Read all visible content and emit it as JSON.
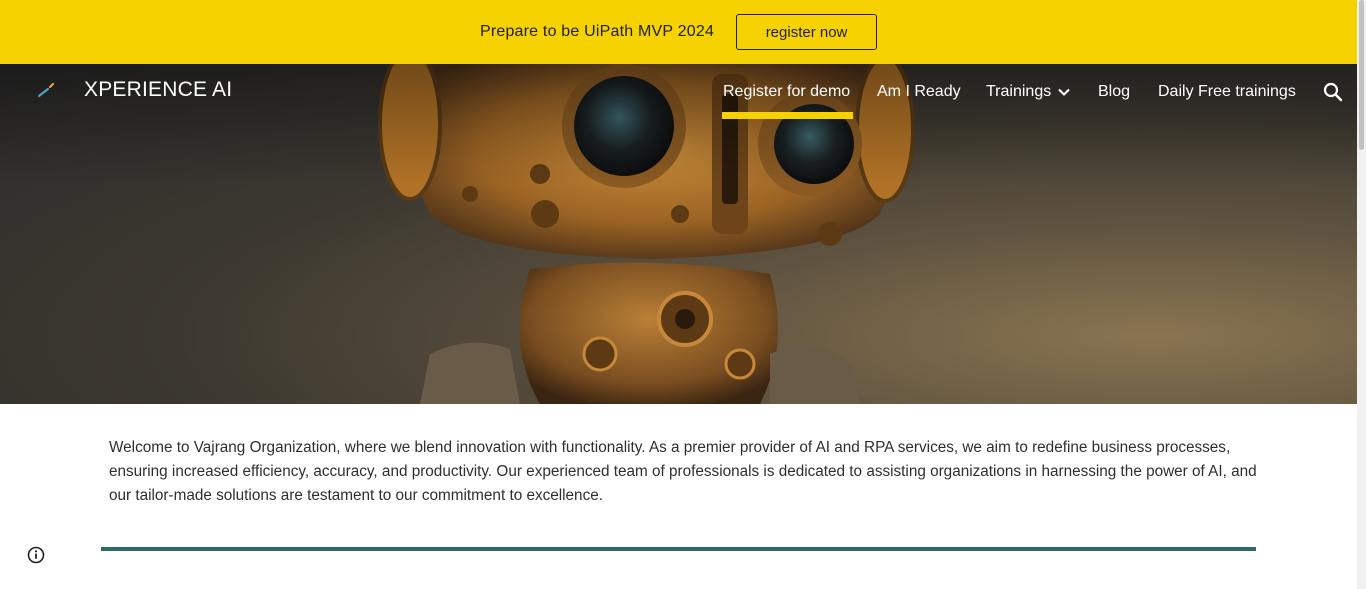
{
  "banner": {
    "text": "Prepare to be UiPath MVP 2024",
    "button_label": "register now",
    "background": "#f5d200"
  },
  "header": {
    "site_title": "XPERIENCE AI",
    "logo_icon": "xperience-logo-icon",
    "nav_items": [
      {
        "label": "Register for demo",
        "active": true
      },
      {
        "label": "Am I Ready"
      },
      {
        "label": "Trainings",
        "has_dropdown": true,
        "icon": "chevron-down-icon"
      },
      {
        "label": "Blog"
      },
      {
        "label": "Daily Free trainings"
      }
    ],
    "search_icon": "search-icon",
    "accent_color": "#f5d200"
  },
  "hero": {
    "image": "robot-hero-image"
  },
  "main": {
    "intro_text": "Welcome to Vajrang Organization, where we blend innovation with functionality. As a premier provider of AI and RPA services, we aim to redefine business processes, ensuring increased efficiency, accuracy, and productivity. Our experienced team of professionals is dedicated to assisting organizations in harnessing the power of AI, and our tailor-made solutions are testament to our commitment to excellence.",
    "divider_color": "#2e6b66"
  },
  "footer": {
    "info_icon": "info-icon"
  }
}
